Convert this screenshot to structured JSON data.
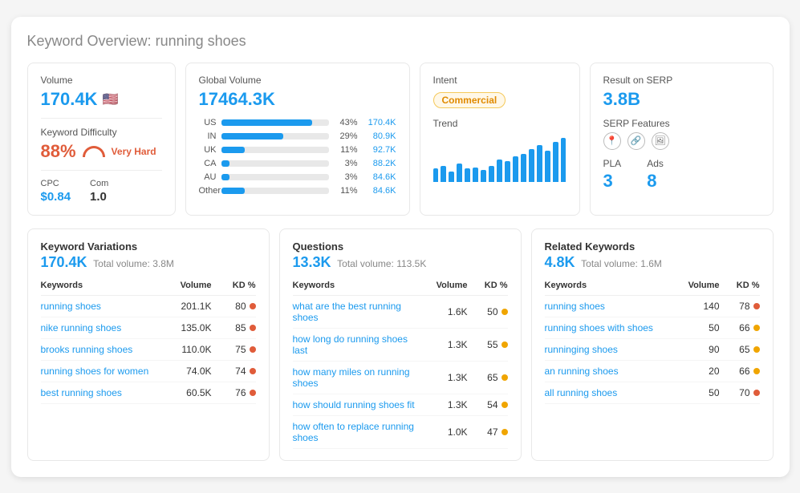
{
  "page": {
    "title_static": "Keyword Overview:",
    "title_keyword": "running shoes"
  },
  "volume_card": {
    "label": "Volume",
    "value": "170.4K",
    "flag": "🇺🇸",
    "kd_label": "Keyword Difficulty",
    "kd_value": "88%",
    "kd_text": "Very Hard",
    "cpc_label": "CPC",
    "cpc_value": "$0.84",
    "com_label": "Com",
    "com_value": "1.0"
  },
  "global_card": {
    "label": "Global Volume",
    "value": "17464.3K",
    "rows": [
      {
        "country": "US",
        "pct": "43%",
        "val": "170.4K",
        "fill": 85
      },
      {
        "country": "IN",
        "pct": "29%",
        "val": "80.9K",
        "fill": 58
      },
      {
        "country": "UK",
        "pct": "11%",
        "val": "92.7K",
        "fill": 22
      },
      {
        "country": "CA",
        "pct": "3%",
        "val": "88.2K",
        "fill": 8
      },
      {
        "country": "AU",
        "pct": "3%",
        "val": "84.6K",
        "fill": 8
      },
      {
        "country": "Other",
        "pct": "11%",
        "val": "84.6K",
        "fill": 22
      }
    ]
  },
  "intent_card": {
    "label": "Intent",
    "badge": "Commercial",
    "trend_label": "Trend",
    "trend_bars": [
      18,
      22,
      14,
      25,
      18,
      20,
      16,
      22,
      30,
      28,
      35,
      38,
      45,
      50,
      42,
      55,
      60
    ]
  },
  "serp_card": {
    "label": "Result on SERP",
    "value": "3.8B",
    "features_label": "SERP Features",
    "icons": [
      "📍",
      "🔗",
      "🖼"
    ],
    "pla_label": "PLA",
    "pla_value": "3",
    "ads_label": "Ads",
    "ads_value": "8"
  },
  "keyword_variations": {
    "section_title": "Keyword Variations",
    "count": "170.4K",
    "total_label": "Total volume: 3.8M",
    "col_keywords": "Keywords",
    "col_volume": "Volume",
    "col_kd": "KD %",
    "rows": [
      {
        "keyword": "running shoes",
        "volume": "201.1K",
        "kd": "80",
        "dot": "red"
      },
      {
        "keyword": "nike running shoes",
        "volume": "135.0K",
        "kd": "85",
        "dot": "red"
      },
      {
        "keyword": "brooks running shoes",
        "volume": "110.0K",
        "kd": "75",
        "dot": "red"
      },
      {
        "keyword": "running shoes for women",
        "volume": "74.0K",
        "kd": "74",
        "dot": "red"
      },
      {
        "keyword": "best running shoes",
        "volume": "60.5K",
        "kd": "76",
        "dot": "red"
      }
    ]
  },
  "questions": {
    "section_title": "Questions",
    "count": "13.3K",
    "total_label": "Total volume: 113.5K",
    "col_keywords": "Keywords",
    "col_volume": "Volume",
    "col_kd": "KD %",
    "rows": [
      {
        "keyword": "what are the best running shoes",
        "volume": "1.6K",
        "kd": "50",
        "dot": "orange"
      },
      {
        "keyword": "how long do running shoes last",
        "volume": "1.3K",
        "kd": "55",
        "dot": "orange"
      },
      {
        "keyword": "how many miles on running shoes",
        "volume": "1.3K",
        "kd": "65",
        "dot": "orange"
      },
      {
        "keyword": "how should running shoes fit",
        "volume": "1.3K",
        "kd": "54",
        "dot": "orange"
      },
      {
        "keyword": "how often to replace running shoes",
        "volume": "1.0K",
        "kd": "47",
        "dot": "orange"
      }
    ]
  },
  "related_keywords": {
    "section_title": "Related Keywords",
    "count": "4.8K",
    "total_label": "Total volume: 1.6M",
    "col_keywords": "Keywords",
    "col_volume": "Volume",
    "col_kd": "KD %",
    "rows": [
      {
        "keyword": "running shoes",
        "volume": "140",
        "kd": "78",
        "dot": "red"
      },
      {
        "keyword": "running shoes with shoes",
        "volume": "50",
        "kd": "66",
        "dot": "orange"
      },
      {
        "keyword": "runninging shoes",
        "volume": "90",
        "kd": "65",
        "dot": "orange"
      },
      {
        "keyword": "an running shoes",
        "volume": "20",
        "kd": "66",
        "dot": "orange"
      },
      {
        "keyword": "all running shoes",
        "volume": "50",
        "kd": "70",
        "dot": "red"
      }
    ]
  }
}
